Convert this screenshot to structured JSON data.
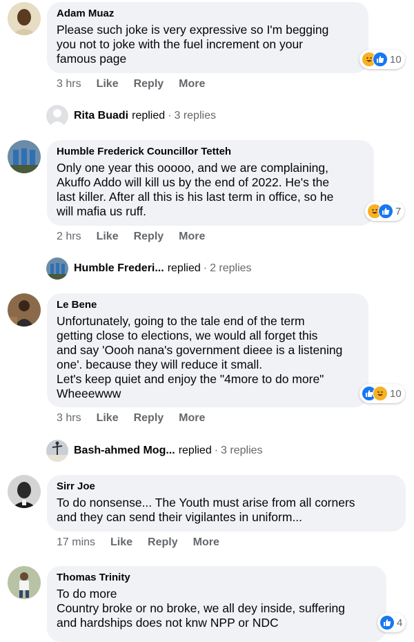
{
  "comments": [
    {
      "author": "Adam Muaz",
      "text": "Please such joke is very expressive so I'm begging\nyou not to joke with the fuel increment on your\nfamous page",
      "time": "3 hrs",
      "reaction_count": "10",
      "reply_preview": {
        "name": "Rita Buadi",
        "replied": "replied",
        "count": "3 replies"
      }
    },
    {
      "author": "Humble Frederick Councillor Tetteh",
      "text": "Only one year this ooooo, and we are complaining,\nAkuffo Addo will kill us by the end of 2022. He's the\nlast killer. After all this is his last term in office, so he\nwill mafia us ruff.",
      "time": "2 hrs",
      "reaction_count": "7",
      "reply_preview": {
        "name": "Humble Frederi...",
        "replied": "replied",
        "count": "2 replies"
      }
    },
    {
      "author": "Le Bene",
      "text": "Unfortunately, going to the tale end of the term\ngetting close to elections, we would all forget this\nand say 'Oooh nana's government dieee is a listening\none'. because they will reduce it small.\nLet's keep quiet and enjoy the \"4more to do more\"\nWheeewww",
      "time": "3 hrs",
      "reaction_count": "10",
      "reply_preview": {
        "name": "Bash-ahmed Mog...",
        "replied": "replied",
        "count": "3 replies"
      }
    },
    {
      "author": "Sirr Joe",
      "text": "To do nonsense... The Youth must arise from all corners\nand they can send their vigilantes in uniform...",
      "time": "17 mins"
    },
    {
      "author": "Thomas Trinity",
      "text": "To do more\nCountry broke or no broke, we all dey inside, suffering\nand hardships does not knw NPP or NDC",
      "reaction_count": "4"
    }
  ],
  "actions": {
    "like": "Like",
    "reply": "Reply",
    "more": "More"
  },
  "separator": "·",
  "icons": {
    "haha": "haha-reaction-icon",
    "like": "like-reaction-icon"
  },
  "colors": {
    "bubble": "#f0f2f5",
    "secondary_text": "#65676b",
    "like_blue": "#1877f2",
    "haha_yellow": "#f7b125"
  }
}
